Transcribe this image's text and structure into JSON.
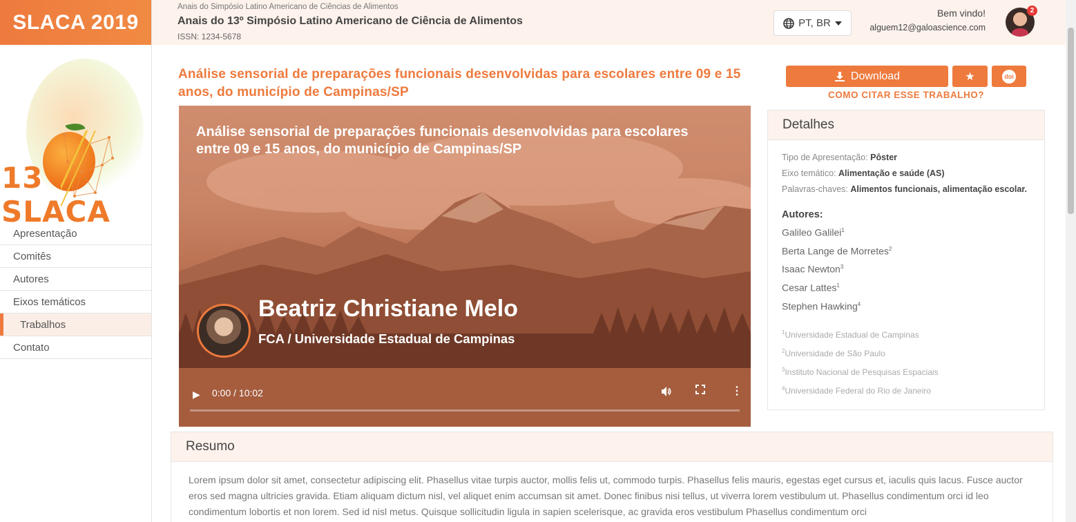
{
  "sidebar": {
    "brand": "SLACA 2019",
    "logo_text": "13 SLACA",
    "nav": [
      {
        "label": "Apresentação"
      },
      {
        "label": "Comitês"
      },
      {
        "label": "Autores"
      },
      {
        "label": "Eixos temáticos"
      },
      {
        "label": "Trabalhos",
        "active": true
      },
      {
        "label": "Contato"
      }
    ]
  },
  "header": {
    "event_small": "Anais do Simpósio Latino Americano de Ciências de Alimentos",
    "event_title": "Anais do 13º Simpósio Latino Americano de Ciência de Alimentos",
    "issn": "ISSN: 1234-5678",
    "language": "PT, BR",
    "welcome": "Bem vindo!",
    "email": "alguem12@galoascience.com",
    "notification_count": "2"
  },
  "paper": {
    "title": "Análise sensorial de preparações funcionais desenvolvidas para escolares entre 09 e 15 anos, do município de Campinas/SP"
  },
  "video": {
    "title": "Análise sensorial de preparações funcionais desenvolvidas para escolares entre 09 e 15 anos, do município de Campinas/SP",
    "presenter_name": "Beatriz Christiane Melo",
    "presenter_affiliation": "FCA / Universidade Estadual de Campinas",
    "time": "0:00 / 10:02"
  },
  "actions": {
    "download_label": "Download",
    "cite_label": "COMO CITAR ESSE TRABALHO?",
    "doi_label": "doi"
  },
  "details": {
    "heading": "Detalhes",
    "type_label": "Tipo de Apresentação:",
    "type_value": "Pôster",
    "axis_label": "Eixo temático:",
    "axis_value": "Alimentação e saúde (AS)",
    "keywords_label": "Palavras-chaves:",
    "keywords_value": "Alimentos funcionais, alimentação escolar.",
    "authors_heading": "Autores:",
    "authors": [
      {
        "name": "Galileo Galilei",
        "sup": "1"
      },
      {
        "name": "Berta Lange de Morretes",
        "sup": "2"
      },
      {
        "name": "Isaac Newton",
        "sup": "3"
      },
      {
        "name": "Cesar Lattes",
        "sup": "1"
      },
      {
        "name": "Stephen Hawking",
        "sup": "4"
      }
    ],
    "institutions": [
      {
        "sup": "1",
        "name": "Universidade Estadual de Campinas"
      },
      {
        "sup": "2",
        "name": "Universidade de São Paulo"
      },
      {
        "sup": "3",
        "name": "Instituto Nacional de Pesquisas Espaciais"
      },
      {
        "sup": "4",
        "name": "Universidade Federal do Rio de Janeiro"
      }
    ]
  },
  "resumo": {
    "heading": "Resumo",
    "text": "Lorem ipsum dolor sit amet, consectetur adipiscing elit. Phasellus vitae turpis auctor, mollis felis ut, commodo turpis. Phasellus felis mauris, egestas eget cursus et, iaculis quis lacus. Fusce auctor eros sed magna ultricies gravida. Etiam aliquam dictum nisl, vel aliquet enim accumsan sit amet. Donec finibus nisi tellus, ut viverra lorem vestibulum ut. Phasellus condimentum orci id leo condimentum lobortis et non lorem. Sed id nisl metus. Quisque sollicitudin ligula in sapien scelerisque, ac gravida eros vestibulum Phasellus condimentum orci"
  },
  "colors": {
    "accent": "#ee7a3d",
    "header_bg": "#fdf2ec"
  }
}
